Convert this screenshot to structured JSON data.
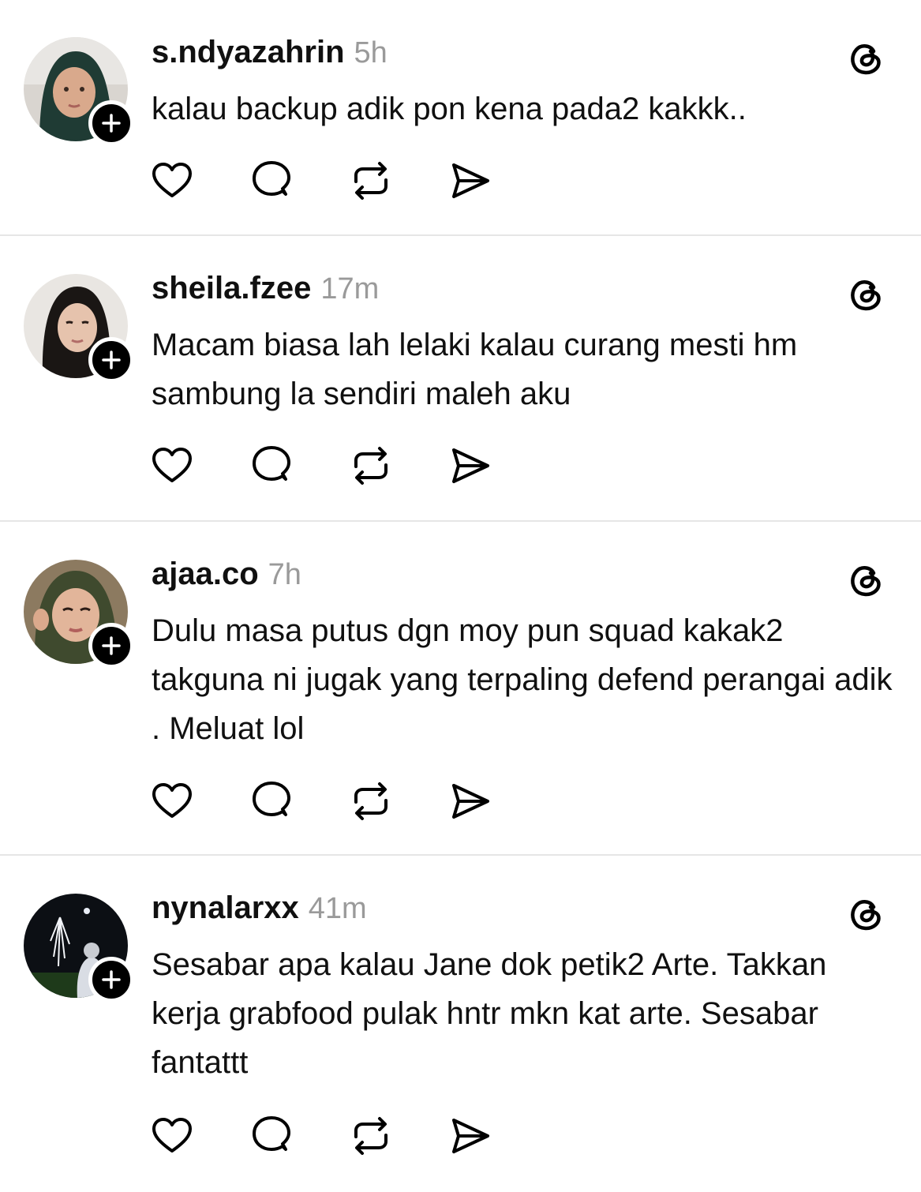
{
  "posts": [
    {
      "username": "s.ndyazahrin",
      "time": "5h",
      "text": "kalau backup adik pon kena pada2 kakkk..",
      "avatar_colors": {
        "bg": "#d9d5d0",
        "hijab": "#1f3b34",
        "face": "#d9a98c"
      }
    },
    {
      "username": "sheila.fzee",
      "time": "17m",
      "text": "Macam biasa lah lelaki kalau curang mesti hm sambung la sendiri maleh aku",
      "avatar_colors": {
        "bg": "#e9e6e2",
        "hijab": "#1a1614",
        "face": "#e6c3ad"
      }
    },
    {
      "username": "ajaa.co",
      "time": "7h",
      "text": "Dulu masa putus dgn moy pun squad kakak2 takguna ni jugak yang terpaling defend perangai adik . Meluat lol",
      "avatar_colors": {
        "bg": "#8c7a60",
        "hijab": "#3f4a2e",
        "face": "#e2b59a"
      }
    },
    {
      "username": "nynalarxx",
      "time": "41m",
      "text": "Sesabar apa kalau Jane dok petik2 Arte. Takkan kerja grabfood pulak hntr mkn kat arte. Sesabar fantattt",
      "avatar_colors": {
        "bg": "#0c0f14",
        "hijab": "#d9dde4",
        "face": "#c9ccd2"
      }
    }
  ],
  "icons": {
    "follow": "plus-icon",
    "app": "threads-logo-icon",
    "like": "heart-icon",
    "reply": "comment-bubble-icon",
    "repost": "repost-icon",
    "share": "send-icon"
  }
}
